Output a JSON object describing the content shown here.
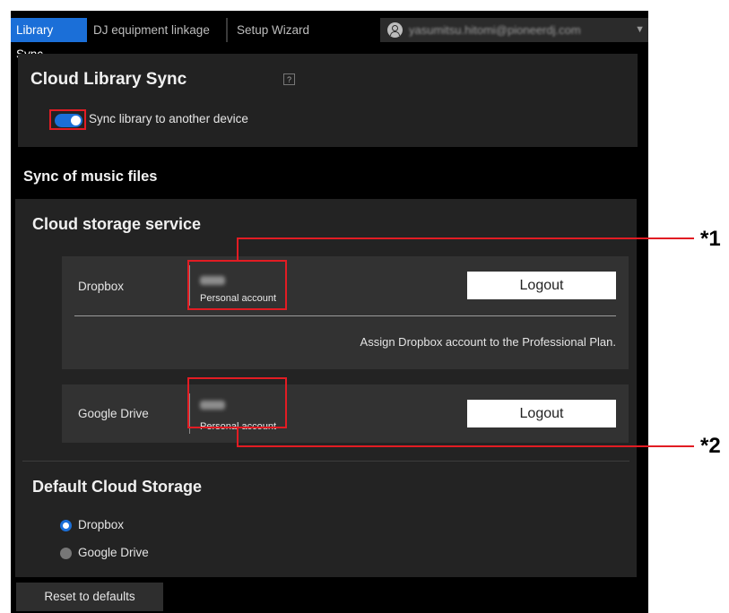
{
  "tabs": [
    "Library Sync",
    "DJ equipment linkage",
    "Setup Wizard"
  ],
  "user": {
    "email": "yasumitsu.hitomi@pioneerdj.com",
    "icon": "user-icon",
    "caret": "▼"
  },
  "sync_panel": {
    "title": "Cloud Library Sync",
    "help": "?",
    "toggle_label": "Sync library to another device",
    "toggle_on": true
  },
  "section_title": "Sync of music files",
  "cloud": {
    "title": "Cloud storage service",
    "dropbox": {
      "label": "Dropbox",
      "account_type": "Personal account",
      "logout": "Logout",
      "note": "Assign Dropbox account to the Professional Plan."
    },
    "gdrive": {
      "label": "Google Drive",
      "account_type": "Personal account",
      "logout": "Logout"
    },
    "default_title": "Default Cloud Storage",
    "options": [
      {
        "label": "Dropbox",
        "selected": true
      },
      {
        "label": "Google Drive",
        "selected": false
      }
    ]
  },
  "reset_label": "Reset to defaults",
  "annotations": {
    "note1": "*1",
    "note2": "*2"
  },
  "colors": {
    "accent": "#1b6fd8",
    "highlight": "#e21c23"
  }
}
